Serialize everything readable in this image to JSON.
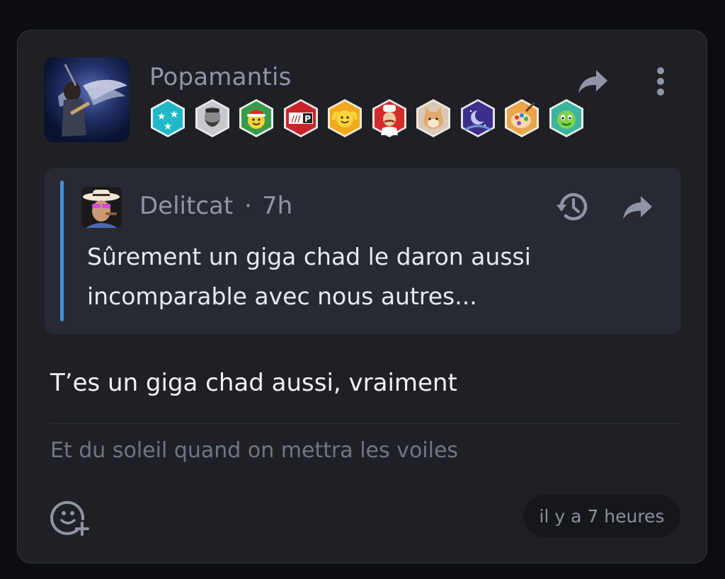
{
  "post": {
    "author": "Popamantis",
    "badges": [
      "stars-badge-icon",
      "bearded-man-badge-icon",
      "christmas-smiley-badge-icon",
      "p-logo-badge-icon",
      "cheering-smiley-badge-icon",
      "chef-badge-icon",
      "cat-badge-icon",
      "moon-badge-icon",
      "palette-badge-icon",
      "green-smiley-badge-icon"
    ],
    "share_icon": "share-icon",
    "more_icon": "more-vertical-icon",
    "body": "T’es un giga chad aussi, vraiment",
    "signature": "Et du soleil quand on mettra les voiles",
    "timestamp": "il y a 7 heures",
    "react_icon": "add-reaction-icon"
  },
  "quote": {
    "author": "Delitcat",
    "separator": "·",
    "time": "7h",
    "text": "Sûrement un giga chad le daron aussi incomparable avec nous autres...",
    "history_icon": "history-icon",
    "share_icon": "share-icon"
  },
  "colors": {
    "background": "#0c0d10",
    "card": "#1e2026",
    "quote_bg": "#272a32",
    "quote_accent": "#4a8ed8",
    "muted_text": "#8e96a6"
  }
}
